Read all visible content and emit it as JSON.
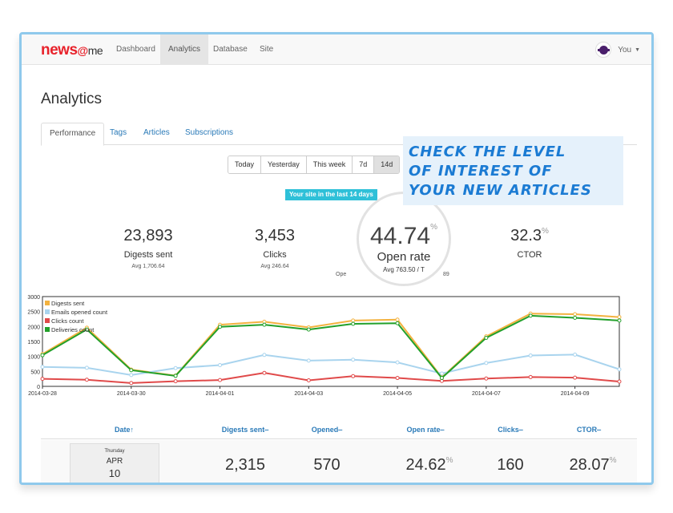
{
  "brand": {
    "news": "news",
    "at": "@",
    "me": "me"
  },
  "nav": {
    "items": [
      {
        "label": "Dashboard",
        "active": false
      },
      {
        "label": "Analytics",
        "active": true
      },
      {
        "label": "Database",
        "active": false
      },
      {
        "label": "Site",
        "active": false
      }
    ],
    "user": "You"
  },
  "page": {
    "title": "Analytics"
  },
  "tabs": [
    {
      "label": "Performance",
      "active": true
    },
    {
      "label": "Tags",
      "active": false
    },
    {
      "label": "Articles",
      "active": false
    },
    {
      "label": "Subscriptions",
      "active": false
    }
  ],
  "ranges": [
    {
      "label": "Today",
      "active": false
    },
    {
      "label": "Yesterday",
      "active": false
    },
    {
      "label": "This week",
      "active": false
    },
    {
      "label": "7d",
      "active": false
    },
    {
      "label": "14d",
      "active": true
    }
  ],
  "badge": "Your site in the last 14 days",
  "callout": [
    "Check the level",
    "of interest of",
    "your new articles"
  ],
  "kpis": {
    "digests": {
      "value": "23,893",
      "label": "Digests sent",
      "sub": "Avg 1,706.64"
    },
    "clicks": {
      "value": "3,453",
      "label": "Clicks",
      "sub": "Avg 246.64"
    },
    "open_rate": {
      "value": "44.74",
      "unit": "%",
      "label": "Open rate",
      "sub": "Avg 763.50 / T",
      "sub_left": "Ope",
      "sub_right": "89"
    },
    "ctor": {
      "value": "32.3",
      "unit": "%",
      "label": "CTOR"
    }
  },
  "chart_data": {
    "type": "line",
    "x": [
      "2014-03-28",
      "2014-03-29",
      "2014-03-30",
      "2014-03-31",
      "2014-04-01",
      "2014-04-02",
      "2014-04-03",
      "2014-04-04",
      "2014-04-05",
      "2014-04-06",
      "2014-04-07",
      "2014-04-08",
      "2014-04-09",
      "2014-04-10"
    ],
    "xticks": [
      "2014-03-28",
      "2014-03-30",
      "2014-04-01",
      "2014-04-03",
      "2014-04-05",
      "2014-04-07",
      "2014-04-09"
    ],
    "ylim": [
      0,
      3000
    ],
    "yticks": [
      0,
      500,
      1000,
      1500,
      2000,
      2500,
      3000
    ],
    "legend_position": "top-left",
    "series": [
      {
        "name": "Digests sent",
        "color": "#f3b23f",
        "values": [
          1080,
          1960,
          560,
          360,
          2060,
          2160,
          1970,
          2200,
          2230,
          300,
          1670,
          2430,
          2410,
          2315
        ]
      },
      {
        "name": "Emails opened count",
        "color": "#a9d4ee",
        "values": [
          650,
          620,
          380,
          610,
          710,
          1050,
          860,
          890,
          800,
          430,
          780,
          1030,
          1060,
          570
        ]
      },
      {
        "name": "Clicks count",
        "color": "#e04a4a",
        "values": [
          250,
          220,
          110,
          170,
          210,
          450,
          200,
          340,
          280,
          180,
          260,
          310,
          290,
          160
        ]
      },
      {
        "name": "Deliveries count",
        "color": "#22a02a",
        "values": [
          1040,
          1900,
          540,
          350,
          1990,
          2060,
          1900,
          2090,
          2110,
          280,
          1620,
          2360,
          2290,
          2200
        ]
      }
    ]
  },
  "table": {
    "headers": [
      {
        "label": "Date",
        "sort": "↑"
      },
      {
        "label": "Digests sent",
        "sort": "‒"
      },
      {
        "label": "Opened",
        "sort": "‒"
      },
      {
        "label": "Open rate",
        "sort": "‒"
      },
      {
        "label": "Clicks",
        "sort": "‒"
      },
      {
        "label": "CTOR",
        "sort": "‒"
      }
    ],
    "row": {
      "day": "Thursday",
      "month": "APR",
      "date": "10",
      "digests": "2,315",
      "opened": "570",
      "open_rate": "24.62",
      "clicks": "160",
      "ctor": "28.07",
      "unit": "%"
    }
  }
}
